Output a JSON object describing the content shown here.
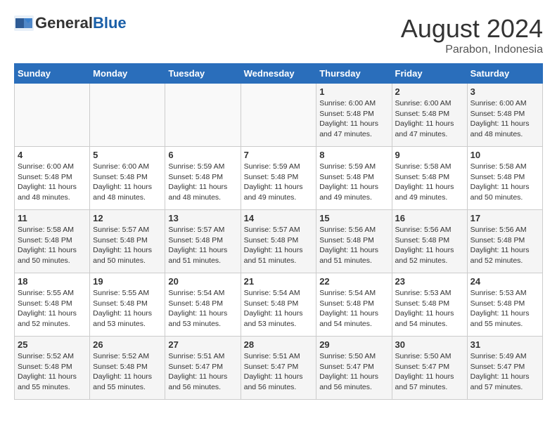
{
  "logo": {
    "general": "General",
    "blue": "Blue"
  },
  "title": {
    "month": "August 2024",
    "location": "Parabon, Indonesia"
  },
  "weekdays": [
    "Sunday",
    "Monday",
    "Tuesday",
    "Wednesday",
    "Thursday",
    "Friday",
    "Saturday"
  ],
  "weeks": [
    [
      {
        "day": "",
        "info": ""
      },
      {
        "day": "",
        "info": ""
      },
      {
        "day": "",
        "info": ""
      },
      {
        "day": "",
        "info": ""
      },
      {
        "day": "1",
        "sunrise": "Sunrise: 6:00 AM",
        "sunset": "Sunset: 5:48 PM",
        "daylight": "Daylight: 11 hours and 47 minutes."
      },
      {
        "day": "2",
        "sunrise": "Sunrise: 6:00 AM",
        "sunset": "Sunset: 5:48 PM",
        "daylight": "Daylight: 11 hours and 47 minutes."
      },
      {
        "day": "3",
        "sunrise": "Sunrise: 6:00 AM",
        "sunset": "Sunset: 5:48 PM",
        "daylight": "Daylight: 11 hours and 48 minutes."
      }
    ],
    [
      {
        "day": "4",
        "sunrise": "Sunrise: 6:00 AM",
        "sunset": "Sunset: 5:48 PM",
        "daylight": "Daylight: 11 hours and 48 minutes."
      },
      {
        "day": "5",
        "sunrise": "Sunrise: 6:00 AM",
        "sunset": "Sunset: 5:48 PM",
        "daylight": "Daylight: 11 hours and 48 minutes."
      },
      {
        "day": "6",
        "sunrise": "Sunrise: 5:59 AM",
        "sunset": "Sunset: 5:48 PM",
        "daylight": "Daylight: 11 hours and 48 minutes."
      },
      {
        "day": "7",
        "sunrise": "Sunrise: 5:59 AM",
        "sunset": "Sunset: 5:48 PM",
        "daylight": "Daylight: 11 hours and 49 minutes."
      },
      {
        "day": "8",
        "sunrise": "Sunrise: 5:59 AM",
        "sunset": "Sunset: 5:48 PM",
        "daylight": "Daylight: 11 hours and 49 minutes."
      },
      {
        "day": "9",
        "sunrise": "Sunrise: 5:58 AM",
        "sunset": "Sunset: 5:48 PM",
        "daylight": "Daylight: 11 hours and 49 minutes."
      },
      {
        "day": "10",
        "sunrise": "Sunrise: 5:58 AM",
        "sunset": "Sunset: 5:48 PM",
        "daylight": "Daylight: 11 hours and 50 minutes."
      }
    ],
    [
      {
        "day": "11",
        "sunrise": "Sunrise: 5:58 AM",
        "sunset": "Sunset: 5:48 PM",
        "daylight": "Daylight: 11 hours and 50 minutes."
      },
      {
        "day": "12",
        "sunrise": "Sunrise: 5:57 AM",
        "sunset": "Sunset: 5:48 PM",
        "daylight": "Daylight: 11 hours and 50 minutes."
      },
      {
        "day": "13",
        "sunrise": "Sunrise: 5:57 AM",
        "sunset": "Sunset: 5:48 PM",
        "daylight": "Daylight: 11 hours and 51 minutes."
      },
      {
        "day": "14",
        "sunrise": "Sunrise: 5:57 AM",
        "sunset": "Sunset: 5:48 PM",
        "daylight": "Daylight: 11 hours and 51 minutes."
      },
      {
        "day": "15",
        "sunrise": "Sunrise: 5:56 AM",
        "sunset": "Sunset: 5:48 PM",
        "daylight": "Daylight: 11 hours and 51 minutes."
      },
      {
        "day": "16",
        "sunrise": "Sunrise: 5:56 AM",
        "sunset": "Sunset: 5:48 PM",
        "daylight": "Daylight: 11 hours and 52 minutes."
      },
      {
        "day": "17",
        "sunrise": "Sunrise: 5:56 AM",
        "sunset": "Sunset: 5:48 PM",
        "daylight": "Daylight: 11 hours and 52 minutes."
      }
    ],
    [
      {
        "day": "18",
        "sunrise": "Sunrise: 5:55 AM",
        "sunset": "Sunset: 5:48 PM",
        "daylight": "Daylight: 11 hours and 52 minutes."
      },
      {
        "day": "19",
        "sunrise": "Sunrise: 5:55 AM",
        "sunset": "Sunset: 5:48 PM",
        "daylight": "Daylight: 11 hours and 53 minutes."
      },
      {
        "day": "20",
        "sunrise": "Sunrise: 5:54 AM",
        "sunset": "Sunset: 5:48 PM",
        "daylight": "Daylight: 11 hours and 53 minutes."
      },
      {
        "day": "21",
        "sunrise": "Sunrise: 5:54 AM",
        "sunset": "Sunset: 5:48 PM",
        "daylight": "Daylight: 11 hours and 53 minutes."
      },
      {
        "day": "22",
        "sunrise": "Sunrise: 5:54 AM",
        "sunset": "Sunset: 5:48 PM",
        "daylight": "Daylight: 11 hours and 54 minutes."
      },
      {
        "day": "23",
        "sunrise": "Sunrise: 5:53 AM",
        "sunset": "Sunset: 5:48 PM",
        "daylight": "Daylight: 11 hours and 54 minutes."
      },
      {
        "day": "24",
        "sunrise": "Sunrise: 5:53 AM",
        "sunset": "Sunset: 5:48 PM",
        "daylight": "Daylight: 11 hours and 55 minutes."
      }
    ],
    [
      {
        "day": "25",
        "sunrise": "Sunrise: 5:52 AM",
        "sunset": "Sunset: 5:48 PM",
        "daylight": "Daylight: 11 hours and 55 minutes."
      },
      {
        "day": "26",
        "sunrise": "Sunrise: 5:52 AM",
        "sunset": "Sunset: 5:48 PM",
        "daylight": "Daylight: 11 hours and 55 minutes."
      },
      {
        "day": "27",
        "sunrise": "Sunrise: 5:51 AM",
        "sunset": "Sunset: 5:47 PM",
        "daylight": "Daylight: 11 hours and 56 minutes."
      },
      {
        "day": "28",
        "sunrise": "Sunrise: 5:51 AM",
        "sunset": "Sunset: 5:47 PM",
        "daylight": "Daylight: 11 hours and 56 minutes."
      },
      {
        "day": "29",
        "sunrise": "Sunrise: 5:50 AM",
        "sunset": "Sunset: 5:47 PM",
        "daylight": "Daylight: 11 hours and 56 minutes."
      },
      {
        "day": "30",
        "sunrise": "Sunrise: 5:50 AM",
        "sunset": "Sunset: 5:47 PM",
        "daylight": "Daylight: 11 hours and 57 minutes."
      },
      {
        "day": "31",
        "sunrise": "Sunrise: 5:49 AM",
        "sunset": "Sunset: 5:47 PM",
        "daylight": "Daylight: 11 hours and 57 minutes."
      }
    ]
  ]
}
